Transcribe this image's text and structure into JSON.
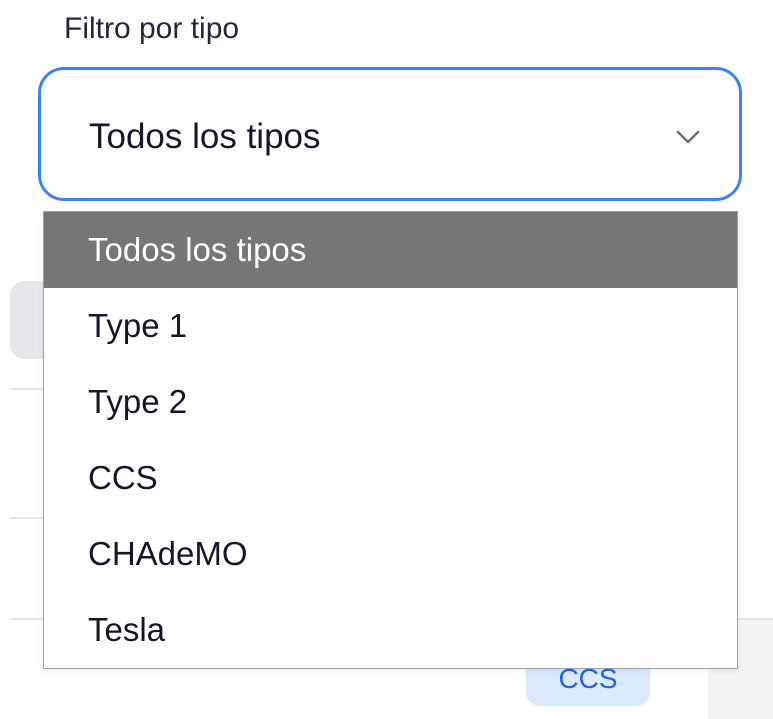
{
  "filter": {
    "label": "Filtro por tipo",
    "selected_value": "Todos los tipos"
  },
  "dropdown": {
    "options": [
      {
        "label": "Todos los tipos",
        "selected": true
      },
      {
        "label": "Type 1",
        "selected": false
      },
      {
        "label": "Type 2",
        "selected": false
      },
      {
        "label": "CCS",
        "selected": false
      },
      {
        "label": "CHAdeMO",
        "selected": false
      },
      {
        "label": "Tesla",
        "selected": false
      }
    ]
  },
  "background": {
    "tag_label": "CCS"
  },
  "colors": {
    "focus_border": "#3b82f6",
    "selected_option_bg": "#767676",
    "tag_bg": "#dbeafe",
    "tag_text": "#2563eb"
  },
  "icons": {
    "select_chevron": "chevron-down-icon"
  }
}
